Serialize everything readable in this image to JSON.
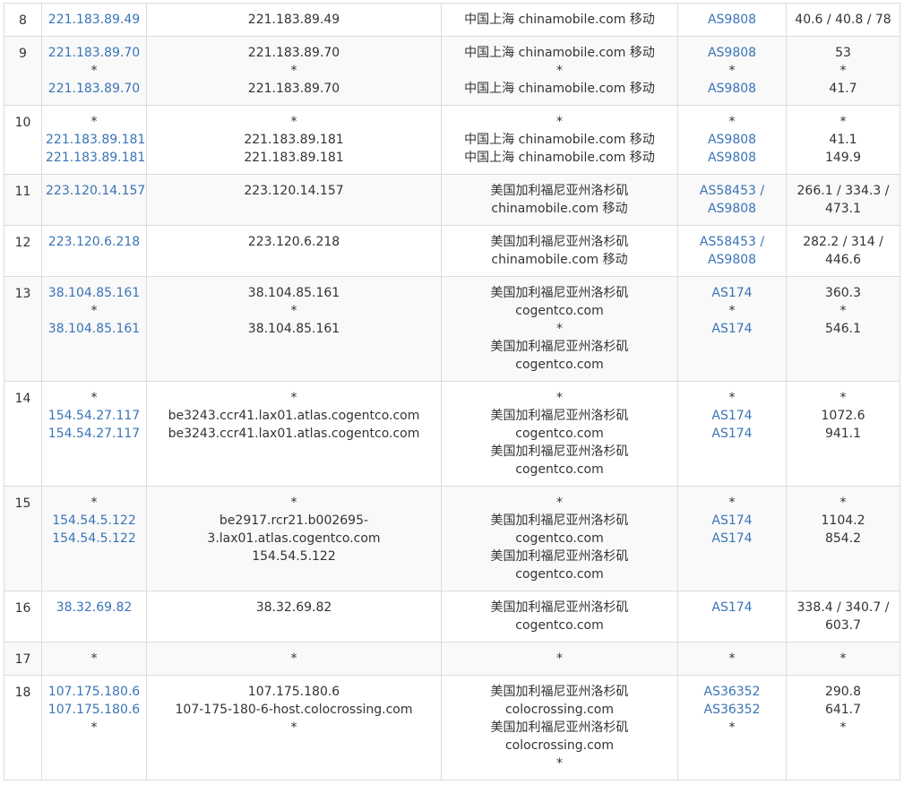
{
  "rows": [
    {
      "hop": "8",
      "ips": [
        "221.183.89.49"
      ],
      "hosts": [
        "221.183.89.49"
      ],
      "geo": [
        "中国上海 chinamobile.com 移动"
      ],
      "asn": [
        "AS9808"
      ],
      "latency": [
        "40.6 / 40.8 / 78"
      ]
    },
    {
      "hop": "9",
      "ips": [
        "221.183.89.70",
        "*",
        "221.183.89.70"
      ],
      "hosts": [
        "221.183.89.70",
        "*",
        "221.183.89.70"
      ],
      "geo": [
        "中国上海 chinamobile.com 移动",
        "*",
        "中国上海 chinamobile.com 移动"
      ],
      "asn": [
        "AS9808",
        "*",
        "AS9808"
      ],
      "latency": [
        "53",
        "*",
        "41.7"
      ]
    },
    {
      "hop": "10",
      "ips": [
        "*",
        "221.183.89.181",
        "221.183.89.181"
      ],
      "hosts": [
        "*",
        "221.183.89.181",
        "221.183.89.181"
      ],
      "geo": [
        "*",
        "中国上海 chinamobile.com 移动",
        "中国上海 chinamobile.com 移动"
      ],
      "asn": [
        "*",
        "AS9808",
        "AS9808"
      ],
      "latency": [
        "*",
        "41.1",
        "149.9"
      ]
    },
    {
      "hop": "11",
      "ips": [
        "223.120.14.157"
      ],
      "hosts": [
        "223.120.14.157"
      ],
      "geo": [
        "美国加利福尼亚州洛杉矶",
        "chinamobile.com 移动"
      ],
      "asn": [
        "AS58453 /",
        "AS9808"
      ],
      "latency": [
        "266.1 / 334.3 /",
        "473.1"
      ]
    },
    {
      "hop": "12",
      "ips": [
        "223.120.6.218"
      ],
      "hosts": [
        "223.120.6.218"
      ],
      "geo": [
        "美国加利福尼亚州洛杉矶",
        "chinamobile.com 移动"
      ],
      "asn": [
        "AS58453 /",
        "AS9808"
      ],
      "latency": [
        "282.2 / 314 /",
        "446.6"
      ]
    },
    {
      "hop": "13",
      "ips": [
        "38.104.85.161",
        "*",
        "38.104.85.161"
      ],
      "hosts": [
        "38.104.85.161",
        "*",
        "38.104.85.161"
      ],
      "geo": [
        "美国加利福尼亚州洛杉矶",
        "cogentco.com",
        "*",
        "美国加利福尼亚州洛杉矶",
        "cogentco.com"
      ],
      "asn": [
        "AS174",
        "*",
        "AS174"
      ],
      "latency": [
        "360.3",
        "*",
        "546.1"
      ]
    },
    {
      "hop": "14",
      "ips": [
        "*",
        "154.54.27.117",
        "154.54.27.117"
      ],
      "hosts": [
        "*",
        "be3243.ccr41.lax01.atlas.cogentco.com",
        "be3243.ccr41.lax01.atlas.cogentco.com"
      ],
      "geo": [
        "*",
        "美国加利福尼亚州洛杉矶",
        "cogentco.com",
        "美国加利福尼亚州洛杉矶",
        "cogentco.com"
      ],
      "asn": [
        "*",
        "AS174",
        "AS174"
      ],
      "latency": [
        "*",
        "1072.6",
        "941.1"
      ]
    },
    {
      "hop": "15",
      "ips": [
        "*",
        "154.54.5.122",
        "154.54.5.122"
      ],
      "hosts": [
        "*",
        "be2917.rcr21.b002695-",
        "3.lax01.atlas.cogentco.com",
        "154.54.5.122"
      ],
      "geo": [
        "*",
        "美国加利福尼亚州洛杉矶",
        "cogentco.com",
        "美国加利福尼亚州洛杉矶",
        "cogentco.com"
      ],
      "asn": [
        "*",
        "AS174",
        "AS174"
      ],
      "latency": [
        "*",
        "1104.2",
        "854.2"
      ]
    },
    {
      "hop": "16",
      "ips": [
        "38.32.69.82"
      ],
      "hosts": [
        "38.32.69.82"
      ],
      "geo": [
        "美国加利福尼亚州洛杉矶",
        "cogentco.com"
      ],
      "asn": [
        "AS174"
      ],
      "latency": [
        "338.4 / 340.7 /",
        "603.7"
      ]
    },
    {
      "hop": "17",
      "ips": [
        "*"
      ],
      "hosts": [
        "*"
      ],
      "geo": [
        "*"
      ],
      "asn": [
        "*"
      ],
      "latency": [
        "*"
      ]
    },
    {
      "hop": "18",
      "ips": [
        "107.175.180.6",
        "107.175.180.6",
        "*"
      ],
      "hosts": [
        "107.175.180.6",
        "107-175-180-6-host.colocrossing.com",
        "*"
      ],
      "geo": [
        "美国加利福尼亚州洛杉矶",
        "colocrossing.com",
        "美国加利福尼亚州洛杉矶",
        "colocrossing.com",
        "*"
      ],
      "asn": [
        "AS36352",
        "AS36352",
        "*"
      ],
      "latency": [
        "290.8",
        "641.7",
        "*"
      ]
    }
  ]
}
